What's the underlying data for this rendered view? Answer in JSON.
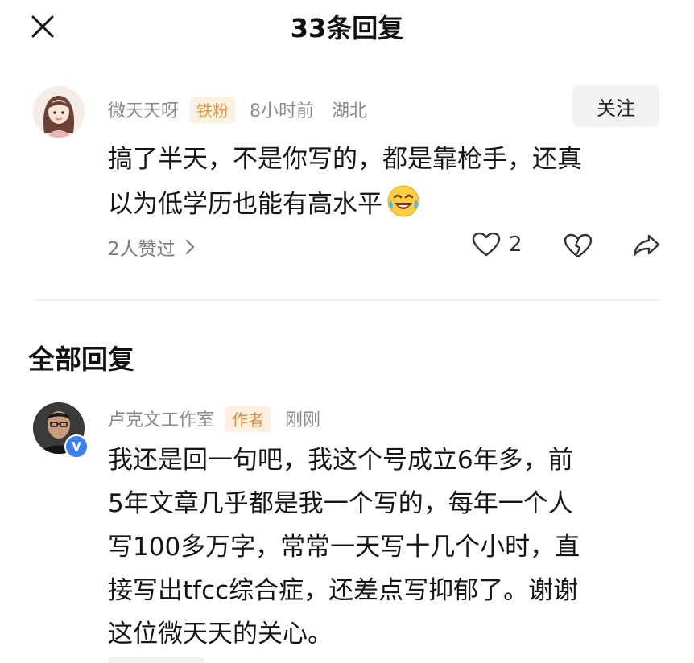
{
  "header": {
    "title": "33条回复",
    "close_icon": "close-icon"
  },
  "top_comment": {
    "username": "微天天呀",
    "badge": "铁粉",
    "time": "8小时前",
    "location": "湖北",
    "follow_label": "关注",
    "text_line1": "搞了半天，不是你写的，都是靠枪手，还真",
    "text_line2": "以为低学历也能有高水平",
    "emoji": "crying-laughing-emoji",
    "likes_summary": "2人赞过",
    "like_count": "2"
  },
  "section": {
    "title": "全部回复"
  },
  "reply": {
    "username": "卢克文工作室",
    "badge": "作者",
    "time": "刚刚",
    "verified_mark": "V",
    "lines": [
      "我还是回一句吧，我这个号成立6年多，前",
      "5年文章几乎都是我一个写的，每年一个人",
      "写100多万字，常常一天写十几个小时，直",
      "接写出tfcc综合症，还差点写抑郁了。谢谢",
      "这位微天天的关心。"
    ]
  },
  "colors": {
    "badge_orange": "#e0973b",
    "badge_bg": "#fbf1e3",
    "meta_gray": "#8a8a8a",
    "verified_blue": "#3b7ff2"
  }
}
